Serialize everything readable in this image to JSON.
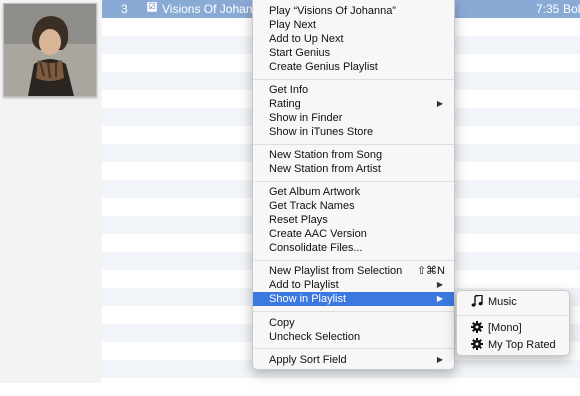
{
  "selected_track": {
    "number": "3",
    "checkbox": "☑",
    "name": "Visions Of Johanna",
    "time": "7:35",
    "artist": "Bob Dyl"
  },
  "context_menu": {
    "items": [
      {
        "label": "Play “Visions Of Johanna”"
      },
      {
        "label": "Play Next"
      },
      {
        "label": "Add to Up Next"
      },
      {
        "label": "Start Genius"
      },
      {
        "label": "Create Genius Playlist"
      },
      {
        "label": "Get Info"
      },
      {
        "label": "Rating",
        "submenu_arrow": "▶"
      },
      {
        "label": "Show in Finder"
      },
      {
        "label": "Show in iTunes Store"
      },
      {
        "label": "New Station from Song"
      },
      {
        "label": "New Station from Artist"
      },
      {
        "label": "Get Album Artwork"
      },
      {
        "label": "Get Track Names"
      },
      {
        "label": "Reset Plays"
      },
      {
        "label": "Create AAC Version"
      },
      {
        "label": "Consolidate Files..."
      },
      {
        "label": "New Playlist from Selection",
        "shortcut": "⇧⌘N"
      },
      {
        "label": "Add to Playlist",
        "submenu_arrow": "▶"
      },
      {
        "label": "Show in Playlist",
        "submenu_arrow": "▶",
        "highlighted": true
      },
      {
        "label": "Copy"
      },
      {
        "label": "Uncheck Selection"
      },
      {
        "label": "Apply Sort Field",
        "submenu_arrow": "▶"
      }
    ]
  },
  "playlist_submenu": {
    "items": [
      {
        "label": "Music",
        "icon": "music-note-icon"
      },
      {
        "label": "[Mono]",
        "icon": "gear-icon"
      },
      {
        "label": "My Top Rated",
        "icon": "gear-icon"
      }
    ]
  },
  "colors": {
    "selection_row": "#8aaad6",
    "menu_highlight": "#3b78e0",
    "alt_row": "#f1f4f8"
  }
}
